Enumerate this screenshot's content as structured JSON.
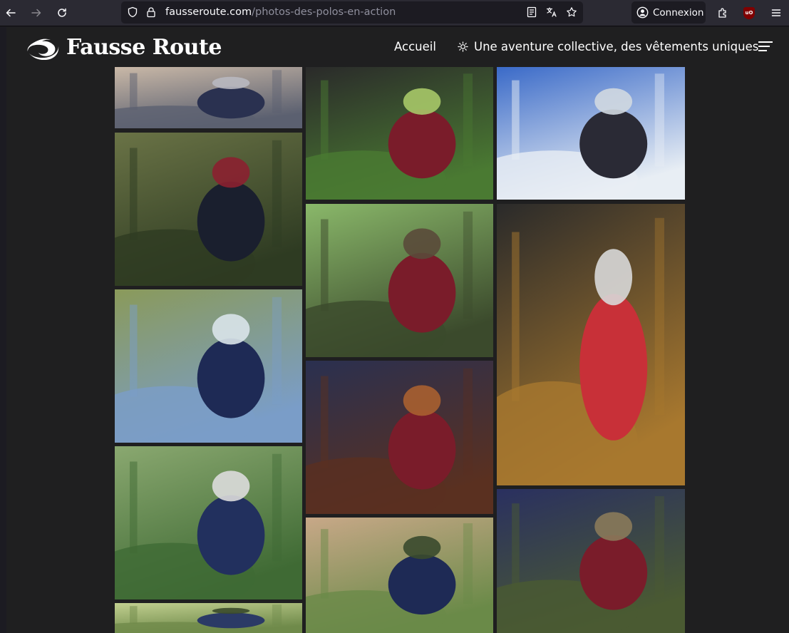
{
  "browser": {
    "url_domain": "fausseroute.com",
    "url_path": "/photos-des-polos-en-action",
    "login_label": "Connexion"
  },
  "site": {
    "logo_text": "Fausse Route",
    "nav": {
      "home_label": "Accueil",
      "aventure_label": "Une aventure collective, des vêtements uniques"
    }
  },
  "gallery": {
    "photos": [
      {
        "subject": "cyclist-arm-road",
        "palette": [
          "#5b6070",
          "#2a3150",
          "#c9b8a7",
          "#b8b8c0"
        ]
      },
      {
        "subject": "cyclists-forest-break",
        "palette": [
          "#2e3b22",
          "#1a1f2e",
          "#6a7346",
          "#8b2030"
        ]
      },
      {
        "subject": "cyclist-map-mountain",
        "palette": [
          "#7a9dc8",
          "#1e2a55",
          "#8a9a5a",
          "#d9e4ea"
        ]
      },
      {
        "subject": "cyclist-helmet-forest-stream",
        "palette": [
          "#3f6a34",
          "#22305e",
          "#8aa870",
          "#dcdcdc"
        ]
      },
      {
        "subject": "cyclist-helmet-portrait",
        "palette": [
          "#6f8a4a",
          "#2b3a66",
          "#c2d090",
          "#3a4a2a"
        ]
      },
      {
        "subject": "cyclist-riding-road-sunny",
        "palette": [
          "#4a7a32",
          "#7a1c2a",
          "#2a2a2a",
          "#a7c868"
        ]
      },
      {
        "subject": "cyclist-forest-path",
        "palette": [
          "#3b4a2c",
          "#7a1c2a",
          "#8ab86a",
          "#5a4a3a"
        ]
      },
      {
        "subject": "group-selfie-autumn-forest",
        "palette": [
          "#5a3020",
          "#7a1c2a",
          "#2a3050",
          "#a86030"
        ]
      },
      {
        "subject": "cyclist-portrait-trees",
        "palette": [
          "#6a8a48",
          "#1e2a55",
          "#c8a888",
          "#3a4a2e"
        ]
      },
      {
        "subject": "ski-poles-snow",
        "palette": [
          "#e8eef4",
          "#2a2a35",
          "#3a6ac8",
          "#d0d8e0"
        ]
      },
      {
        "subject": "cap-on-bag",
        "palette": [
          "#a8782e",
          "#c83038",
          "#2a2a2a",
          "#d8d8d8"
        ]
      },
      {
        "subject": "group-forest-trail",
        "palette": [
          "#4a5a32",
          "#7a1c2a",
          "#2a3060",
          "#8a7a5a"
        ]
      }
    ]
  }
}
